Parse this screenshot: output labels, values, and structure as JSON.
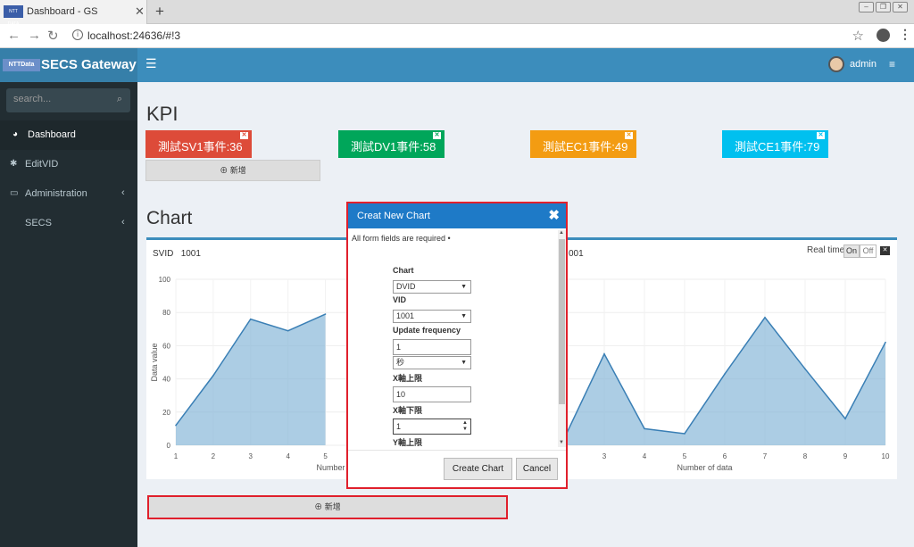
{
  "browser": {
    "tab_title": "Dashboard - GS",
    "favicon_text": "NTT DATA",
    "url": "localhost:24636/#!3"
  },
  "header": {
    "logo_badge": "NTTData",
    "app_name": "SECS Gateway",
    "username": "admin"
  },
  "sidebar": {
    "search_placeholder": "search...",
    "items": [
      {
        "label": "Dashboard",
        "icon": "dashboard-icon"
      },
      {
        "label": "EditVID",
        "icon": "gear-icon"
      },
      {
        "label": "Administration",
        "icon": "monitor-icon"
      },
      {
        "label": "SECS",
        "icon": ""
      }
    ]
  },
  "kpi": {
    "title": "KPI",
    "items": [
      {
        "label": "測試SV1事件:36",
        "color": "#dd4b39"
      },
      {
        "label": "測試DV1事件:58",
        "color": "#00a65a"
      },
      {
        "label": "測試EC1事件:49",
        "color": "#f39c12"
      },
      {
        "label": "測試CE1事件:79",
        "color": "#00c0ef"
      }
    ],
    "add_label": "新增"
  },
  "chart_section": {
    "title": "Chart",
    "svid_label": "SVID",
    "svid_value": "1001",
    "svid_value_right": "001",
    "realtime_label": "Real time",
    "on_label": "On",
    "off_label": "Off",
    "add_label": "新增"
  },
  "chart_data": [
    {
      "type": "area",
      "x": [
        1,
        2,
        3,
        4,
        5
      ],
      "y": [
        12,
        42,
        76,
        69,
        79
      ],
      "ylabel": "Data value",
      "xlabel": "Number of data",
      "ylim": [
        0,
        100
      ],
      "yticks": [
        0,
        20,
        40,
        60,
        80,
        100
      ],
      "color": "#7fb2d6"
    },
    {
      "type": "area",
      "x": [
        1,
        2,
        3,
        4,
        5,
        6,
        7,
        8,
        9,
        10
      ],
      "y": [
        30,
        4,
        55,
        10,
        7,
        43,
        77,
        46,
        16,
        62
      ],
      "ylabel": "",
      "xlabel": "Number of data",
      "ylim": [
        0,
        100
      ],
      "color": "#7fb2d6"
    }
  ],
  "modal": {
    "title": "Creat New Chart",
    "required_note": "All form fields are required •",
    "fields": {
      "chart_label": "Chart",
      "chart_value": "DVID",
      "vid_label": "VID",
      "vid_value": "1001",
      "freq_label": "Update frequency",
      "freq_value": "1",
      "freq_unit": "秒",
      "xmax_label": "X軸上限",
      "xmax_value": "10",
      "xmin_label": "X軸下限",
      "xmin_value": "1",
      "ymax_label": "Y軸上限"
    },
    "create_label": "Create Chart",
    "cancel_label": "Cancel"
  }
}
